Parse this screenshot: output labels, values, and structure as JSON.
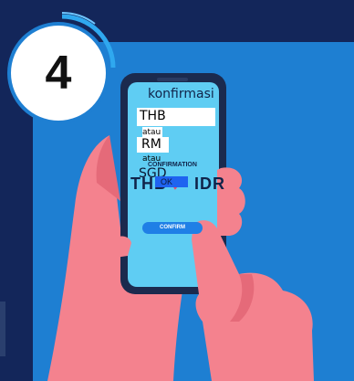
{
  "badge": {
    "number": "4"
  },
  "screen": {
    "title": "konfirmasi",
    "option_1": "THB",
    "separator_1": "atau",
    "option_2": "RM",
    "separator_2": "atau",
    "option_3": "SGD",
    "ok_label": "OK",
    "confirmation_heading": "CONFIRMATION",
    "rate_from": "THB",
    "rate_to": "IDR",
    "confirm_label": "CONFIRM"
  },
  "colors": {
    "background": "#13265a",
    "panel": "#1e7fd2",
    "phone_screen": "#5fcdf3",
    "hand": "#f4828e",
    "accent": "#1f63f0"
  }
}
